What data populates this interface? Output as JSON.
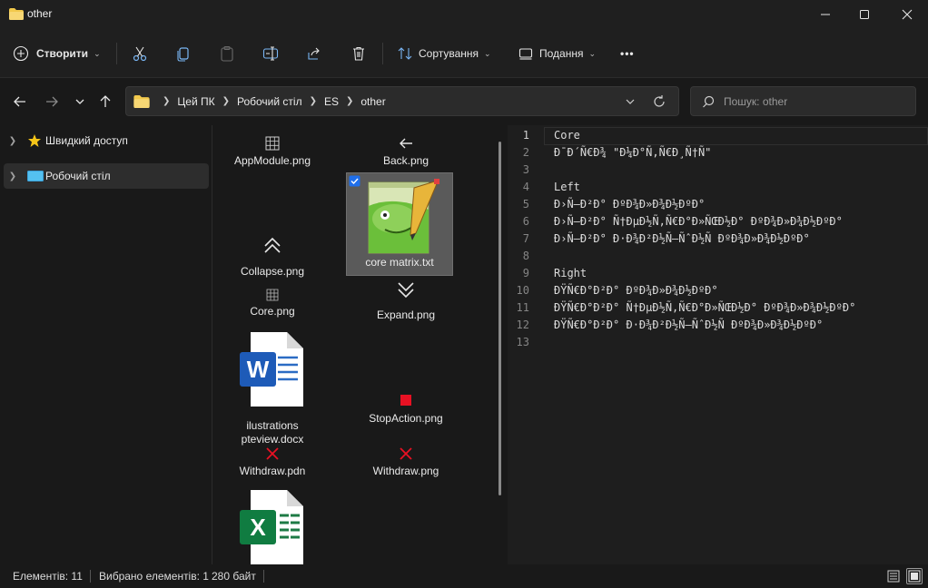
{
  "window": {
    "title": "other"
  },
  "commandbar": {
    "new_label": "Створити",
    "sort_label": "Сортування",
    "view_label": "Подання",
    "more_label": "•••"
  },
  "address": {
    "crumbs": [
      "Цей ПК",
      "Робочий стіл",
      "ES",
      "other"
    ]
  },
  "search": {
    "placeholder": "Пошук: other"
  },
  "sidebar": {
    "items": [
      {
        "label": "Швидкий доступ"
      },
      {
        "label": "Робочий стіл"
      }
    ]
  },
  "files": [
    {
      "name": "AppModule.png"
    },
    {
      "name": "Back.png"
    },
    {
      "name": "core matrix.txt"
    },
    {
      "name": "Collapse.png"
    },
    {
      "name": "Core.png"
    },
    {
      "name": "Expand.png"
    },
    {
      "name": "ilustrations pteview.docx"
    },
    {
      "name": "StopAction.png"
    },
    {
      "name": "Withdraw.pdn"
    },
    {
      "name": "Withdraw.png"
    },
    {
      "name": ""
    }
  ],
  "preview": {
    "lines": [
      {
        "n": "1",
        "text": "Core"
      },
      {
        "n": "2",
        "text": "Ð¯Ð´Ñ€Ð¾ \"Ð¼Ð°Ñ‚Ñ€Ð¸Ñ†Ñ\""
      },
      {
        "n": "3",
        "text": ""
      },
      {
        "n": "4",
        "text": "Left"
      },
      {
        "n": "5",
        "text": "Ð›Ñ–Ð²Ð° ÐºÐ¾Ð»Ð¾Ð½ÐºÐ°"
      },
      {
        "n": "6",
        "text": "Ð›Ñ–Ð²Ð° Ñ†ÐµÐ½Ñ‚Ñ€Ð°Ð»ÑŒÐ½Ð° ÐºÐ¾Ð»Ð¾Ð½ÐºÐ°"
      },
      {
        "n": "7",
        "text": "Ð›Ñ–Ð²Ð° Ð·Ð¾Ð²Ð½Ñ–ÑˆÐ½Ñ ÐºÐ¾Ð»Ð¾Ð½ÐºÐ°"
      },
      {
        "n": "8",
        "text": ""
      },
      {
        "n": "9",
        "text": "Right"
      },
      {
        "n": "10",
        "text": "ÐŸÑ€Ð°Ð²Ð° ÐºÐ¾Ð»Ð¾Ð½ÐºÐ°"
      },
      {
        "n": "11",
        "text": "ÐŸÑ€Ð°Ð²Ð° Ñ†ÐµÐ½Ñ‚Ñ€Ð°Ð»ÑŒÐ½Ð° ÐºÐ¾Ð»Ð¾Ð½ÐºÐ°"
      },
      {
        "n": "12",
        "text": "ÐŸÑ€Ð°Ð²Ð° Ð·Ð¾Ð²Ð½Ñ–ÑˆÐ½Ñ ÐºÐ¾Ð»Ð¾Ð½ÐºÐ°"
      },
      {
        "n": "13",
        "text": ""
      }
    ]
  },
  "status": {
    "items_count": "Елементів: 11",
    "selected": "Вибрано елементів: 1",
    "size": "280 байт"
  },
  "colors": {
    "accent": "#1f6feb",
    "folder": "#f2c94c",
    "stop": "#e81123"
  }
}
